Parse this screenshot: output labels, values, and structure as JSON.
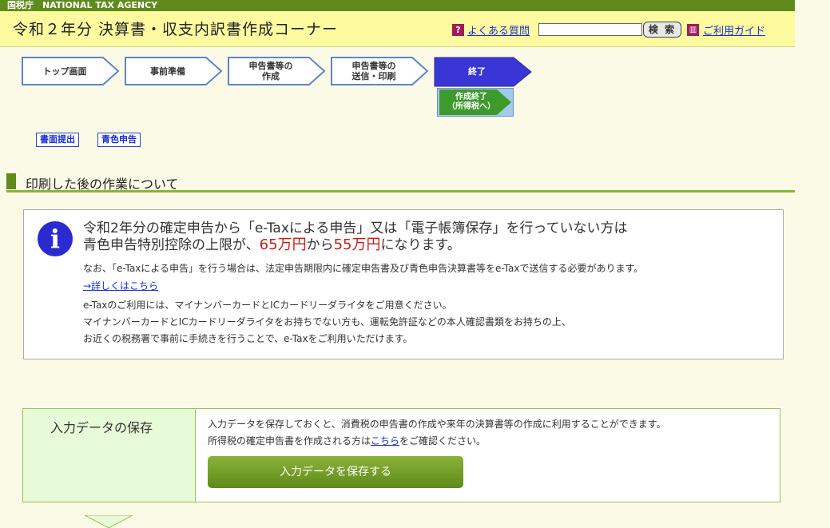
{
  "agency": "国税庁　NATIONAL TAX AGENCY",
  "header": {
    "title": "令和２年分 決算書・収支内訳書作成コーナー",
    "faq_label": "よくある質問",
    "search_value": "",
    "search_button": "検 索",
    "guide_label": "ご利用ガイド"
  },
  "steps": [
    {
      "line1": "トップ画面",
      "line2": ""
    },
    {
      "line1": "事前準備",
      "line2": ""
    },
    {
      "line1": "申告書等の",
      "line2": "作成"
    },
    {
      "line1": "申告書等の",
      "line2": "送信・印刷"
    },
    {
      "line1": "終了",
      "line2": ""
    }
  ],
  "end_note": {
    "line1": "作成終了",
    "line2": "（所得税へ）"
  },
  "tags": [
    "書面提出",
    "青色申告"
  ],
  "section_title": "印刷した後の作業について",
  "info": {
    "line1": "令和2年分の確定申告から「e-Taxによる申告」又は「電子帳簿保存」を行っていない方は",
    "line2_a": "青色申告特別控除の上限が、",
    "line2_b": "65万円",
    "line2_c": "から",
    "line2_d": "55万円",
    "line2_e": "になります。",
    "note1": "なお、「e-Taxによる申告」を行う場合は、法定申告期限内に確定申告書及び青色申告決算書等をe-Taxで送信する必要があります。",
    "detail_link": "→詳しくはこちら",
    "note2": "e-Taxのご利用には、マイナンバーカードとICカードリーダライタをご用意ください。",
    "note3": "マイナンバーカードとICカードリーダライタをお持ちでない方も、運転免許証などの本人確認書類をお持ちの上、",
    "note4": "お近くの税務署で事前に手続きを行うことで、e-Taxをご利用いただけます。"
  },
  "save": {
    "title": "入力データの保存",
    "desc1": "入力データを保存しておくと、消費税の申告書の作成や来年の決算書等の作成に利用することができます。",
    "desc2_a": "所得税の確定申告書を作成される方は",
    "desc2_link": "こちら",
    "desc2_b": "をご確認ください。",
    "button": "入力データを保存する"
  },
  "colors": {
    "brand_green": "#5f8a1c",
    "header_yellow": "#fdfaa0",
    "active_step": "#3a36d6",
    "emphasis_red": "#cc1b1b",
    "link_blue": "#1a2fcf"
  }
}
